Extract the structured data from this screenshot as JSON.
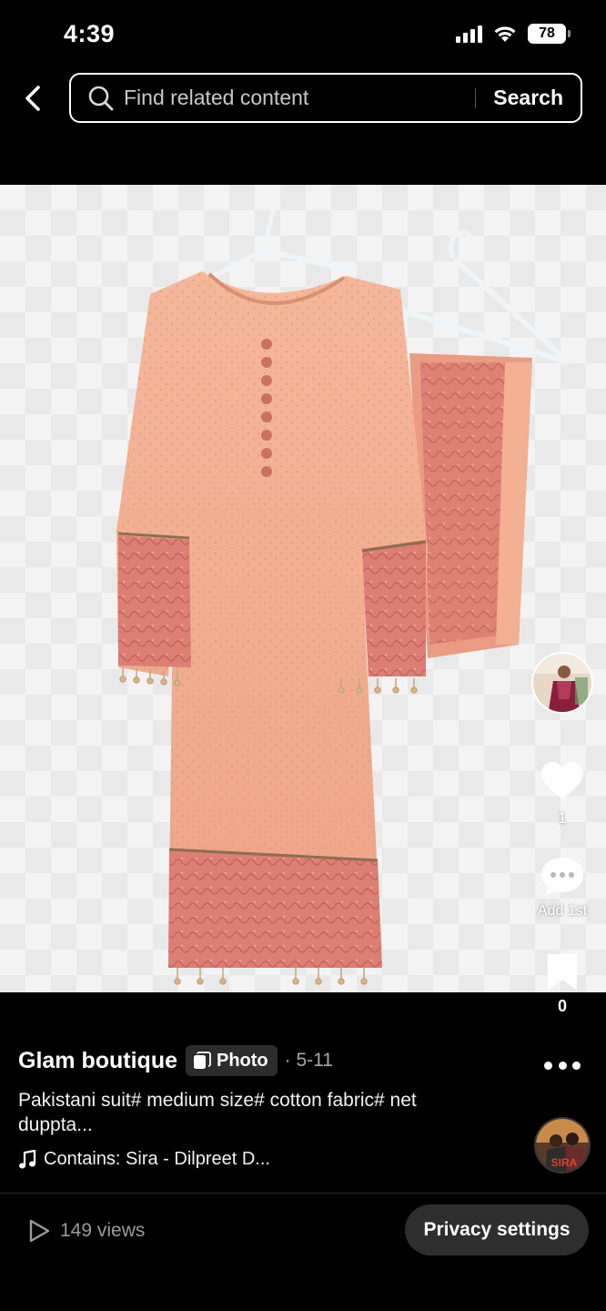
{
  "status_bar": {
    "time": "4:39",
    "battery": "78"
  },
  "search": {
    "placeholder": "Find related content",
    "button_label": "Search"
  },
  "post": {
    "author": "Glam boutique",
    "badge": "Photo",
    "date": "· 5-11",
    "caption": "Pakistani suit# medium size# cotton fabric# net duppta...",
    "music": "Contains: Sira - Dilpreet D...",
    "music_disc_text": "SIRA"
  },
  "actions": {
    "likes": "1",
    "comment_label": "Add 1st",
    "favorites": "0"
  },
  "footer": {
    "views": "149 views",
    "privacy_label": "Privacy settings"
  },
  "colors": {
    "background": "#000000",
    "fabric": "#f1a68a",
    "embroidery": "#d9776e",
    "badge": "#2c2c2c"
  }
}
